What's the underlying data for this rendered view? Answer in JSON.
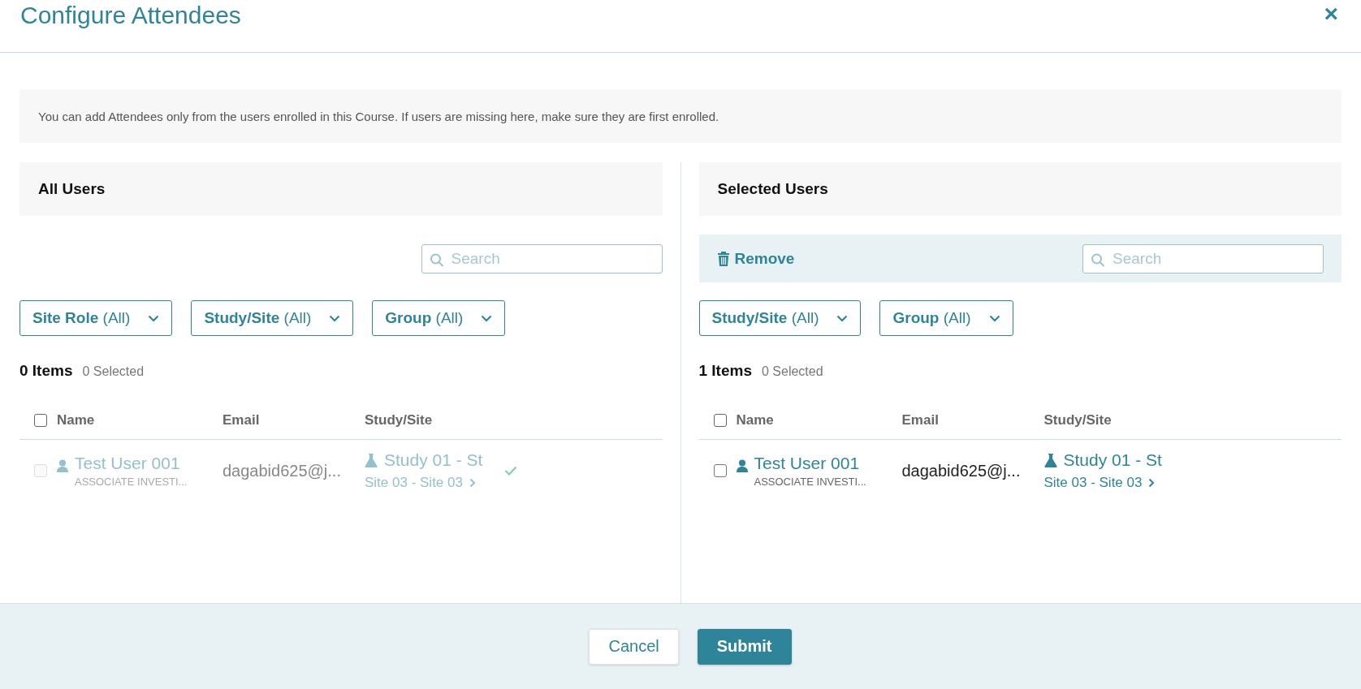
{
  "dialog": {
    "title": "Configure Attendees",
    "close": "×"
  },
  "notice": "You can add Attendees only from the users enrolled in this Course. If users are missing here, make sure they are first enrolled.",
  "panels": [
    {
      "title": "All Users",
      "search": {
        "placeholder": "Search"
      },
      "filters": [
        {
          "label": "**Site Role** (All)"
        },
        {
          "label": "**Study/Site** (All)"
        },
        {
          "label": "**Group** (All)"
        }
      ],
      "count": "0 Items",
      "selected_count": "0 Selected",
      "all_checked": false,
      "columns": [
        "Name",
        "Email",
        "Study/Site"
      ],
      "rows": [
        {
          "checked": false,
          "disabled": true,
          "added": true,
          "name": "Test User 001",
          "role": "ASSOCIATE INVESTI...",
          "email": "dagabid625@j...",
          "study": "Study 01 - St",
          "site": "Site 03 - Site 03"
        }
      ]
    },
    {
      "title": "Selected Users",
      "remove": "Remove",
      "search": {
        "placeholder": "Search"
      },
      "filters": [
        {
          "label": "**Study/Site** (All)"
        },
        {
          "label": "**Group** (All)"
        }
      ],
      "count": "1 Items",
      "selected_count": "0 Selected",
      "all_checked": false,
      "columns": [
        "Name",
        "Email",
        "Study/Site"
      ],
      "rows": [
        {
          "checked": false,
          "disabled": false,
          "added": false,
          "name": "Test User 001",
          "role": "ASSOCIATE INVESTI...",
          "email": "dagabid625@j...",
          "study": "Study 01 - St",
          "site": "Site 03 - Site 03"
        }
      ]
    }
  ],
  "buttons": [
    {
      "kind": "secondary",
      "label": "Cancel"
    },
    {
      "kind": "primary",
      "label": "Submit"
    }
  ]
}
